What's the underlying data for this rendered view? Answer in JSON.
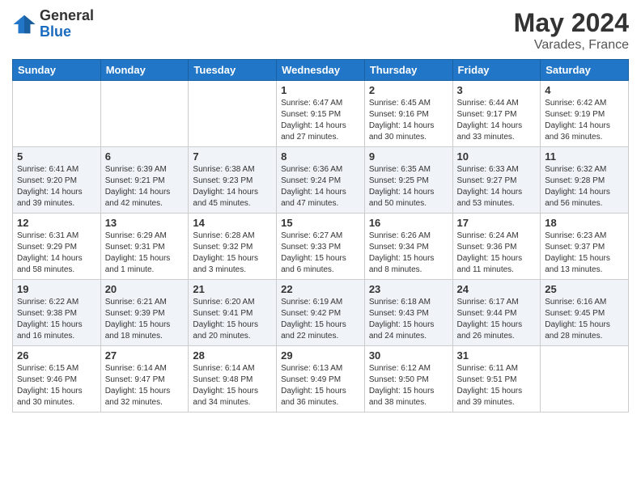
{
  "logo": {
    "general": "General",
    "blue": "Blue"
  },
  "title": {
    "month": "May 2024",
    "location": "Varades, France"
  },
  "headers": [
    "Sunday",
    "Monday",
    "Tuesday",
    "Wednesday",
    "Thursday",
    "Friday",
    "Saturday"
  ],
  "weeks": [
    [
      null,
      null,
      null,
      {
        "day": "1",
        "sunrise": "6:47 AM",
        "sunset": "9:15 PM",
        "daylight": "14 hours and 27 minutes."
      },
      {
        "day": "2",
        "sunrise": "6:45 AM",
        "sunset": "9:16 PM",
        "daylight": "14 hours and 30 minutes."
      },
      {
        "day": "3",
        "sunrise": "6:44 AM",
        "sunset": "9:17 PM",
        "daylight": "14 hours and 33 minutes."
      },
      {
        "day": "4",
        "sunrise": "6:42 AM",
        "sunset": "9:19 PM",
        "daylight": "14 hours and 36 minutes."
      }
    ],
    [
      {
        "day": "5",
        "sunrise": "6:41 AM",
        "sunset": "9:20 PM",
        "daylight": "14 hours and 39 minutes."
      },
      {
        "day": "6",
        "sunrise": "6:39 AM",
        "sunset": "9:21 PM",
        "daylight": "14 hours and 42 minutes."
      },
      {
        "day": "7",
        "sunrise": "6:38 AM",
        "sunset": "9:23 PM",
        "daylight": "14 hours and 45 minutes."
      },
      {
        "day": "8",
        "sunrise": "6:36 AM",
        "sunset": "9:24 PM",
        "daylight": "14 hours and 47 minutes."
      },
      {
        "day": "9",
        "sunrise": "6:35 AM",
        "sunset": "9:25 PM",
        "daylight": "14 hours and 50 minutes."
      },
      {
        "day": "10",
        "sunrise": "6:33 AM",
        "sunset": "9:27 PM",
        "daylight": "14 hours and 53 minutes."
      },
      {
        "day": "11",
        "sunrise": "6:32 AM",
        "sunset": "9:28 PM",
        "daylight": "14 hours and 56 minutes."
      }
    ],
    [
      {
        "day": "12",
        "sunrise": "6:31 AM",
        "sunset": "9:29 PM",
        "daylight": "14 hours and 58 minutes."
      },
      {
        "day": "13",
        "sunrise": "6:29 AM",
        "sunset": "9:31 PM",
        "daylight": "15 hours and 1 minute."
      },
      {
        "day": "14",
        "sunrise": "6:28 AM",
        "sunset": "9:32 PM",
        "daylight": "15 hours and 3 minutes."
      },
      {
        "day": "15",
        "sunrise": "6:27 AM",
        "sunset": "9:33 PM",
        "daylight": "15 hours and 6 minutes."
      },
      {
        "day": "16",
        "sunrise": "6:26 AM",
        "sunset": "9:34 PM",
        "daylight": "15 hours and 8 minutes."
      },
      {
        "day": "17",
        "sunrise": "6:24 AM",
        "sunset": "9:36 PM",
        "daylight": "15 hours and 11 minutes."
      },
      {
        "day": "18",
        "sunrise": "6:23 AM",
        "sunset": "9:37 PM",
        "daylight": "15 hours and 13 minutes."
      }
    ],
    [
      {
        "day": "19",
        "sunrise": "6:22 AM",
        "sunset": "9:38 PM",
        "daylight": "15 hours and 16 minutes."
      },
      {
        "day": "20",
        "sunrise": "6:21 AM",
        "sunset": "9:39 PM",
        "daylight": "15 hours and 18 minutes."
      },
      {
        "day": "21",
        "sunrise": "6:20 AM",
        "sunset": "9:41 PM",
        "daylight": "15 hours and 20 minutes."
      },
      {
        "day": "22",
        "sunrise": "6:19 AM",
        "sunset": "9:42 PM",
        "daylight": "15 hours and 22 minutes."
      },
      {
        "day": "23",
        "sunrise": "6:18 AM",
        "sunset": "9:43 PM",
        "daylight": "15 hours and 24 minutes."
      },
      {
        "day": "24",
        "sunrise": "6:17 AM",
        "sunset": "9:44 PM",
        "daylight": "15 hours and 26 minutes."
      },
      {
        "day": "25",
        "sunrise": "6:16 AM",
        "sunset": "9:45 PM",
        "daylight": "15 hours and 28 minutes."
      }
    ],
    [
      {
        "day": "26",
        "sunrise": "6:15 AM",
        "sunset": "9:46 PM",
        "daylight": "15 hours and 30 minutes."
      },
      {
        "day": "27",
        "sunrise": "6:14 AM",
        "sunset": "9:47 PM",
        "daylight": "15 hours and 32 minutes."
      },
      {
        "day": "28",
        "sunrise": "6:14 AM",
        "sunset": "9:48 PM",
        "daylight": "15 hours and 34 minutes."
      },
      {
        "day": "29",
        "sunrise": "6:13 AM",
        "sunset": "9:49 PM",
        "daylight": "15 hours and 36 minutes."
      },
      {
        "day": "30",
        "sunrise": "6:12 AM",
        "sunset": "9:50 PM",
        "daylight": "15 hours and 38 minutes."
      },
      {
        "day": "31",
        "sunrise": "6:11 AM",
        "sunset": "9:51 PM",
        "daylight": "15 hours and 39 minutes."
      },
      null
    ]
  ]
}
